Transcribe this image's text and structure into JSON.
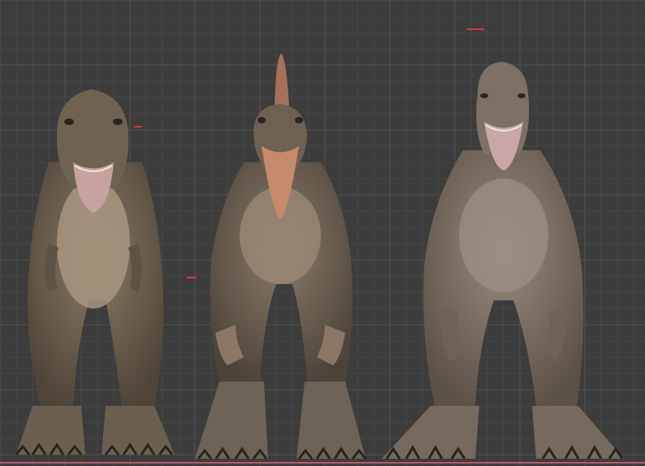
{
  "scene": {
    "background_color": "#3c3c3c",
    "grid_minor_color": "#464646",
    "grid_major_color": "#525252",
    "floor_line_color": "#c0556a",
    "models": [
      {
        "name": "tyrannosaurus-model",
        "skin_color": "#6f6251",
        "belly_color": "#a89580",
        "mouth_color": "#c7a29f"
      },
      {
        "name": "spinosaurus-model",
        "skin_color": "#6e6152",
        "belly_color": "#9a8874",
        "mouth_color": "#c88a6c"
      },
      {
        "name": "giganotosaurus-model",
        "skin_color": "#7d7064",
        "belly_color": "#9d8f84",
        "mouth_color": "#c9a6a8"
      }
    ]
  }
}
